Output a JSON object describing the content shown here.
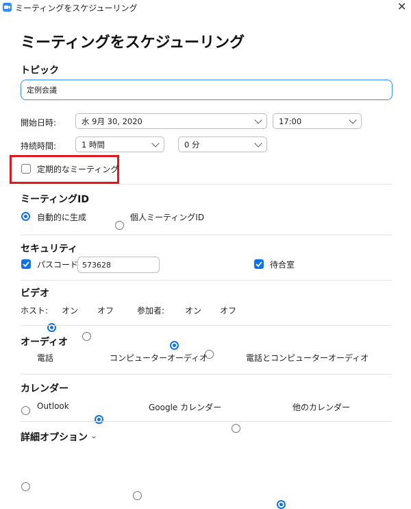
{
  "window": {
    "title": "ミーティングをスケジューリング",
    "close_glyph": "✕"
  },
  "page_title": "ミーティングをスケジューリング",
  "topic": {
    "heading": "トピック",
    "value": "定例会議"
  },
  "start": {
    "label": "開始日時:",
    "date": "水  9月  30, 2020",
    "time": "17:00"
  },
  "duration": {
    "label": "持続時間:",
    "hours": "1 時間",
    "minutes": "0 分"
  },
  "recurring": {
    "label": "定期的なミーティング",
    "checked": false
  },
  "meeting_id": {
    "heading": "ミーティングID",
    "options": [
      {
        "label": "自動的に生成",
        "selected": true
      },
      {
        "label": "個人ミーティングID",
        "selected": false
      }
    ]
  },
  "security": {
    "heading": "セキュリティ",
    "passcode_label": "パスコード",
    "passcode_value": "573628",
    "passcode_checked": true,
    "waiting_room_label": "待合室",
    "waiting_room_checked": true
  },
  "video": {
    "heading": "ビデオ",
    "host_label": "ホスト:",
    "participant_label": "参加者:",
    "on_label": "オン",
    "off_label": "オフ",
    "host_on": true,
    "participant_on": true
  },
  "audio": {
    "heading": "オーディオ",
    "options": [
      {
        "label": "電話",
        "selected": false
      },
      {
        "label": "コンピューターオーディオ",
        "selected": true
      },
      {
        "label": "電話とコンピューターオーディオ",
        "selected": false
      }
    ]
  },
  "calendar": {
    "heading": "カレンダー",
    "options": [
      {
        "label": "Outlook",
        "selected": false
      },
      {
        "label": "Google カレンダー",
        "selected": false
      },
      {
        "label": "他のカレンダー",
        "selected": true
      }
    ]
  },
  "advanced": {
    "label": "詳細オプション",
    "chevron": "⌄"
  },
  "colors": {
    "accent": "#0E72ED",
    "highlight_box": "#E0171E",
    "field_border": "#2D8CFF"
  }
}
